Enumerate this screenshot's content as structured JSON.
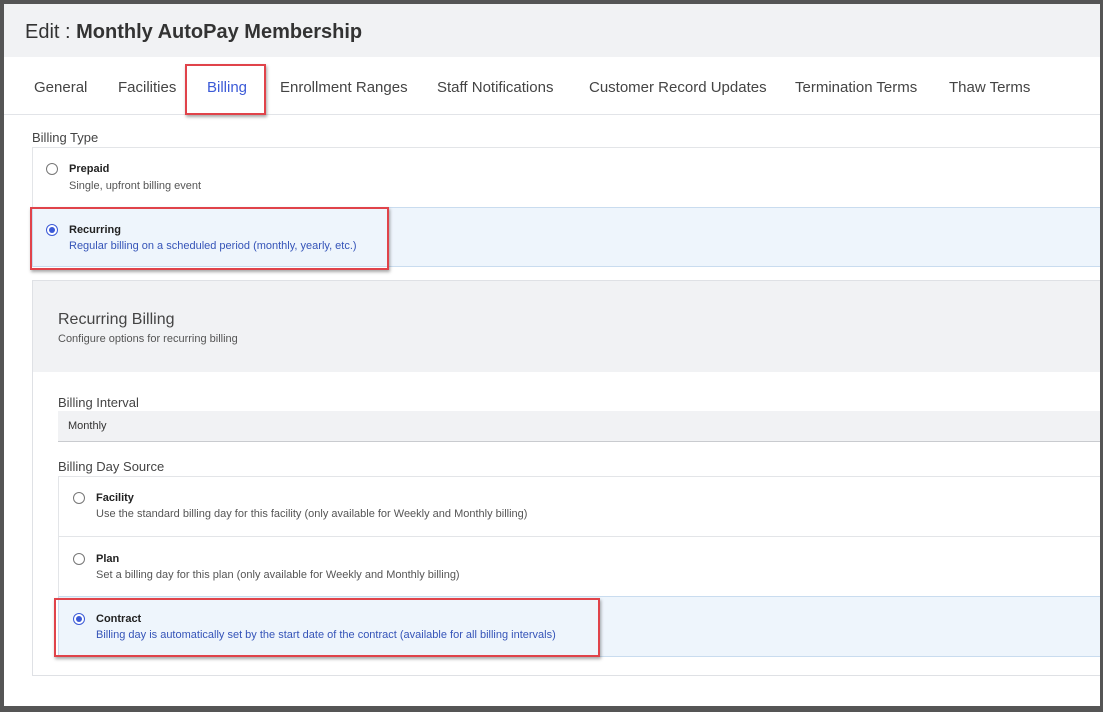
{
  "header": {
    "prefix": "Edit : ",
    "name": "Monthly AutoPay Membership"
  },
  "tabs": [
    {
      "label": "General"
    },
    {
      "label": "Facilities"
    },
    {
      "label": "Billing"
    },
    {
      "label": "Enrollment Ranges"
    },
    {
      "label": "Staff Notifications"
    },
    {
      "label": "Customer Record Updates"
    },
    {
      "label": "Termination Terms"
    },
    {
      "label": "Thaw Terms"
    }
  ],
  "active_tab": "Billing",
  "billing_type": {
    "label": "Billing Type",
    "options": [
      {
        "title": "Prepaid",
        "desc": "Single, upfront billing event",
        "selected": false
      },
      {
        "title": "Recurring",
        "desc": "Regular billing on a scheduled period (monthly, yearly, etc.)",
        "selected": true
      }
    ]
  },
  "recurring_billing": {
    "title": "Recurring Billing",
    "subtitle": "Configure options for recurring billing",
    "interval_label": "Billing Interval",
    "interval_value": "Monthly",
    "day_source_label": "Billing Day Source",
    "day_source_options": [
      {
        "title": "Facility",
        "desc": "Use the standard billing day for this facility (only available for Weekly and Monthly billing)",
        "selected": false
      },
      {
        "title": "Plan",
        "desc": "Set a billing day for this plan (only available for Weekly and Monthly billing)",
        "selected": false
      },
      {
        "title": "Contract",
        "desc": "Billing day is automatically set by the start date of the contract (available for all billing intervals)",
        "selected": true
      }
    ]
  },
  "colors": {
    "accent": "#3b5ad7",
    "highlight": "#e0434a",
    "selected_bg": "#eef5fc"
  }
}
